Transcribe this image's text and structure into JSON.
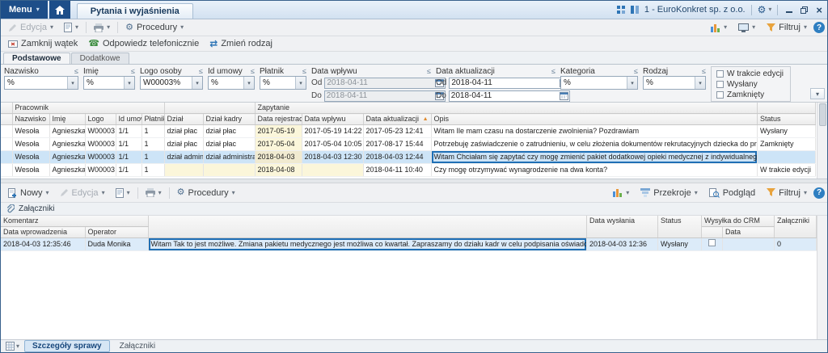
{
  "titlebar": {
    "menu": "Menu",
    "tab": "Pytania i wyjaśnienia",
    "company": "1 - EuroKonkret sp. z o.o."
  },
  "toolbar_top": {
    "edit": "Edycja",
    "procedures": "Procedury",
    "filter": "Filtruj"
  },
  "actions": {
    "close_thread": "Zamknij wątek",
    "reply_phone": "Odpowiedz telefonicznie",
    "change_type": "Zmień rodzaj"
  },
  "filter_tabs": {
    "basic": "Podstawowe",
    "additional": "Dodatkowe"
  },
  "filters": {
    "nazwisko": {
      "label": "Nazwisko",
      "value": "%"
    },
    "imie": {
      "label": "Imię",
      "value": "%"
    },
    "logo_osoby": {
      "label": "Logo osoby",
      "value": "W00003%"
    },
    "id_umowy": {
      "label": "Id umowy",
      "value": "%"
    },
    "platnik": {
      "label": "Płatnik",
      "value": "%"
    },
    "data_wplywu": {
      "label": "Data wpływu",
      "od_label": "Od",
      "do_label": "Do",
      "od": "2018-04-11",
      "do": "2018-04-11"
    },
    "data_aktualizacji": {
      "label": "Data aktualizacji",
      "od_label": "Od",
      "do_label": "Do",
      "od": "2018-04-11",
      "do": "2018-04-11"
    },
    "kategoria": {
      "label": "Kategoria",
      "value": "%"
    },
    "rodzaj": {
      "label": "Rodzaj",
      "value": "%"
    },
    "status_checks": [
      "W trakcie edycji",
      "Wysłany",
      "Zamknięty"
    ]
  },
  "grid1": {
    "bands": {
      "pracownik": "Pracownik",
      "zapytanie": "Zapytanie"
    },
    "headers": {
      "nazwisko": "Nazwisko",
      "imie": "Imię",
      "logo": "Logo",
      "id_umowy": "Id umowy",
      "platnik": "Płatnik",
      "dzial": "Dział",
      "dzial_kadry": "Dział kadry",
      "data_rejestracji": "Data rejestracji",
      "data_wplywu": "Data wpływu",
      "data_aktualizacji": "Data aktualizacji",
      "opis": "Opis",
      "status": "Status"
    },
    "rows": [
      {
        "nazwisko": "Wesoła",
        "imie": "Agnieszka",
        "logo": "W00003",
        "id_umowy": "1/1",
        "platnik": "1",
        "dzial": "dział płac",
        "dzial_kadry": "dział płac",
        "data_rejestracji": "2017-05-19",
        "data_wplywu": "2017-05-19 14:22",
        "data_aktualizacji": "2017-05-23 12:41",
        "opis": "Witam Ile mam czasu na dostarczenie zwolnienia? Pozdrawiam",
        "status": "Wysłany"
      },
      {
        "nazwisko": "Wesoła",
        "imie": "Agnieszka",
        "logo": "W00003",
        "id_umowy": "1/1",
        "platnik": "1",
        "dzial": "dział płac",
        "dzial_kadry": "dział płac",
        "data_rejestracji": "2017-05-04",
        "data_wplywu": "2017-05-04 10:05",
        "data_aktualizacji": "2017-08-17 15:44",
        "opis": "Potrzebuję zaświadczenie o zatrudnieniu, w celu złożenia dokumentów rekrutacyjnych dziecka do przedszkola. Jak mam to załatwić?",
        "status": "Zamknięty"
      },
      {
        "nazwisko": "Wesoła",
        "imie": "Agnieszka",
        "logo": "W00003",
        "id_umowy": "1/1",
        "platnik": "1",
        "dzial": "dział administracji",
        "dzial_kadry": "dział administracji",
        "data_rejestracji": "2018-04-03",
        "data_wplywu": "2018-04-03 12:30",
        "data_aktualizacji": "2018-04-03 12:44",
        "opis": "Witam Chciałam się zapytać czy mogę zmienić pakiet dodatkowej opieki medycznej z indywidualnego na rodzinny? Jeżeli jest to możliwe to od kiedy?",
        "status": ""
      },
      {
        "nazwisko": "Wesoła",
        "imie": "Agnieszka",
        "logo": "W00003",
        "id_umowy": "1/1",
        "platnik": "1",
        "dzial": "",
        "dzial_kadry": "",
        "data_rejestracji": "2018-04-08",
        "data_wplywu": "",
        "data_aktualizacji": "2018-04-11 10:40",
        "opis": "Czy mogę otrzymywać wynagrodzenie na dwa konta?",
        "status": "W trakcie edycji"
      }
    ]
  },
  "toolbar_bottom": {
    "new": "Nowy",
    "edit": "Edycja",
    "procedures": "Procedury",
    "sections": "Przekroje",
    "preview": "Podgląd",
    "filter": "Filtruj"
  },
  "attachments": {
    "label": "Załączniki"
  },
  "grid2": {
    "bands": {
      "komentarz": "Komentarz",
      "wysylka": "Wysyłka do CRM"
    },
    "headers": {
      "data_wprowadzenia": "Data wprowadzenia",
      "operator": "Operator",
      "data_wyslania": "Data wysłania",
      "status": "Status",
      "data": "Data",
      "zalaczniki": "Załączniki"
    },
    "rows": [
      {
        "data_wprowadzenia": "2018-04-03 12:35:46",
        "operator": "Duda Monika",
        "tresc": "Witam  Tak to jest możliwe. Zmiana pakietu medycznego jest możliwa co kwartał. Zapraszamy do działu kadr w celu podpisania oświadczenia. W załączniku Regulamin.",
        "data_wyslania": "2018-04-03 12:36",
        "status": "Wysłany",
        "zalaczniki": "0"
      }
    ]
  },
  "bottom_tabs": {
    "details": "Szczegóły sprawy",
    "attachments": "Załączniki"
  },
  "colors": {
    "accent": "#1d4e89",
    "selection": "#cde4f7",
    "cell_highlight": "#fbf6da",
    "selected_border": "#1f6fb5"
  }
}
